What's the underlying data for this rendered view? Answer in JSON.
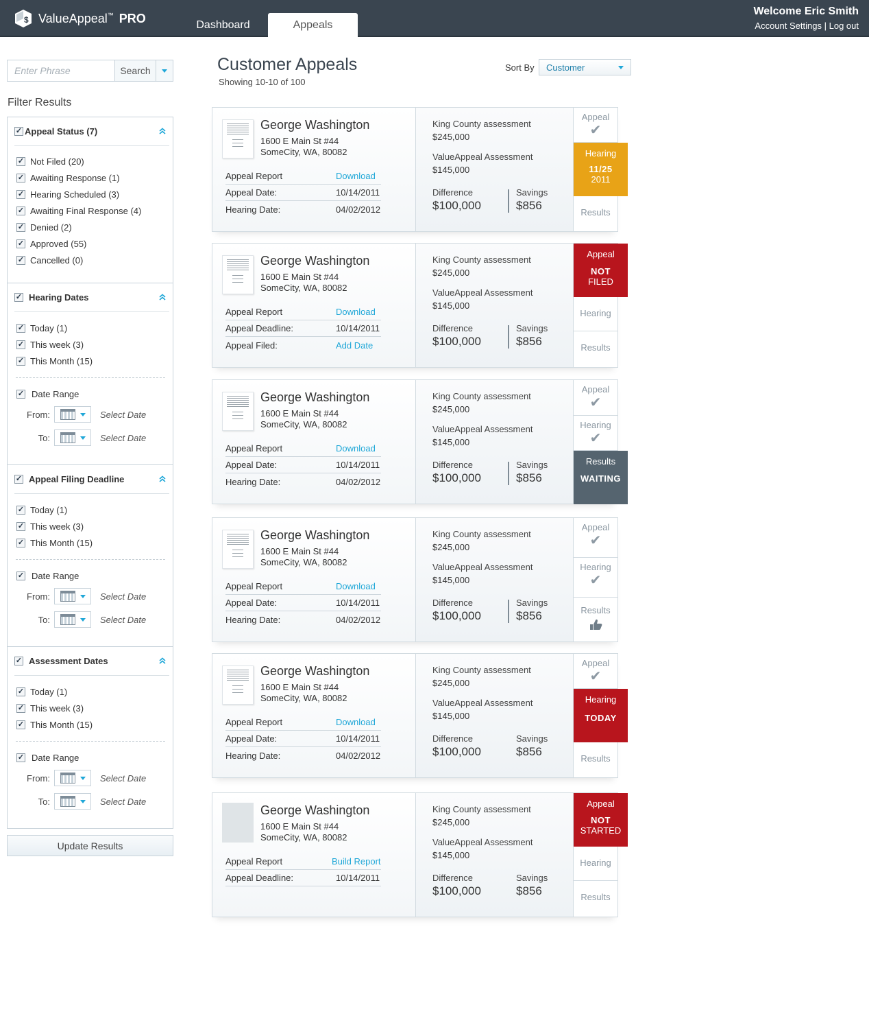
{
  "app": {
    "name": "ValueAppeal",
    "trademark": "™",
    "edition": "PRO"
  },
  "nav": {
    "tabs": [
      {
        "label": "Dashboard",
        "active": false
      },
      {
        "label": "Appeals",
        "active": true
      }
    ]
  },
  "user": {
    "welcome": "Welcome Eric Smith",
    "account_settings": "Account Settings",
    "separator": "|",
    "logout": "Log out"
  },
  "search": {
    "placeholder": "Enter Phrase",
    "button": "Search"
  },
  "filters": {
    "title": "Filter Results",
    "appeal_status": {
      "label": "Appeal Status (7)",
      "items": [
        "Not Filed (20)",
        "Awaiting Response (1)",
        "Hearing Scheduled (3)",
        "Awaiting Final Response (4)",
        "Denied (2)",
        "Approved (55)",
        "Cancelled (0)"
      ]
    },
    "hearing_dates": {
      "label": "Hearing Dates",
      "items": [
        "Today (1)",
        "This week (3)",
        "This Month (15)"
      ],
      "date_range": "Date Range"
    },
    "appeal_filing_deadline": {
      "label": "Appeal Filing Deadline",
      "items": [
        "Today (1)",
        "This week (3)",
        "This Month (15)"
      ],
      "date_range": "Date Range"
    },
    "assessment_dates": {
      "label": "Assessment Dates",
      "items": [
        "Today (1)",
        "This week (3)",
        "This Month (15)"
      ],
      "date_range": "Date Range"
    },
    "from_label": "From:",
    "to_label": "To:",
    "select_date": "Select Date",
    "update_button": "Update Results"
  },
  "main": {
    "title": "Customer Appeals",
    "showing": "Showing 10-10 of 100",
    "sort_by_label": "Sort By",
    "sort_by_value": "Customer"
  },
  "labels": {
    "king_county": "King County assessment",
    "valueappeal_assessment": "ValueAppeal Assessment",
    "difference": "Difference",
    "savings": "Savings",
    "appeal_report": "Appeal Report"
  },
  "cards": [
    {
      "name": "George Washington",
      "address1": "1600 E Main St #44",
      "address2": "SomeCity, WA, 80082",
      "report_action": "Download",
      "row2_label": "Appeal Date:",
      "row2_value": "10/14/2011",
      "row3_label": "Hearing Date:",
      "row3_value": "04/02/2012",
      "king_value": "$245,000",
      "va_value": "$145,000",
      "difference": "$100,000",
      "savings": "$856",
      "status": {
        "appeal": "Appeal",
        "hearing_title": "Hearing",
        "hearing_date": "11/25",
        "hearing_year": "2011",
        "results": "Results"
      }
    },
    {
      "name": "George Washington",
      "address1": "1600 E Main St #44",
      "address2": "SomeCity, WA, 80082",
      "report_action": "Download",
      "row2_label": "Appeal Deadline:",
      "row2_value": "10/14/2011",
      "row3_label": "Appeal Filed:",
      "row3_value": "Add Date",
      "king_value": "$245,000",
      "va_value": "$145,000",
      "difference": "$100,000",
      "savings": "$856",
      "status": {
        "appeal_title": "Appeal",
        "appeal_line1": "NOT",
        "appeal_line2": "FILED",
        "hearing": "Hearing",
        "results": "Results"
      }
    },
    {
      "name": "George Washington",
      "address1": "1600 E Main St #44",
      "address2": "SomeCity, WA, 80082",
      "report_action": "Download",
      "row2_label": "Appeal Date:",
      "row2_value": "10/14/2011",
      "row3_label": "Hearing Date:",
      "row3_value": "04/02/2012",
      "king_value": "$245,000",
      "va_value": "$145,000",
      "difference": "$100,000",
      "savings": "$856",
      "status": {
        "appeal": "Appeal",
        "hearing": "Hearing",
        "results_title": "Results",
        "results_state": "WAITING"
      }
    },
    {
      "name": "George Washington",
      "address1": "1600 E Main St #44",
      "address2": "SomeCity, WA, 80082",
      "report_action": "Download",
      "row2_label": "Appeal Date:",
      "row2_value": "10/14/2011",
      "row3_label": "Hearing Date:",
      "row3_value": "04/02/2012",
      "king_value": "$245,000",
      "va_value": "$145,000",
      "difference": "$100,000",
      "savings": "$856",
      "status": {
        "appeal": "Appeal",
        "hearing": "Hearing",
        "results": "Results"
      }
    },
    {
      "name": "George Washington",
      "address1": "1600 E Main St #44",
      "address2": "SomeCity, WA, 80082",
      "report_action": "Download",
      "row2_label": "Appeal Date:",
      "row2_value": "10/14/2011",
      "row3_label": "Hearing Date:",
      "row3_value": "04/02/2012",
      "king_value": "$245,000",
      "va_value": "$145,000",
      "difference": "$100,000",
      "savings": "$856",
      "status": {
        "appeal": "Appeal",
        "hearing_title": "Hearing",
        "hearing_state": "TODAY",
        "results": "Results"
      }
    },
    {
      "name": "George Washington",
      "address1": "1600 E Main St #44",
      "address2": "SomeCity, WA, 80082",
      "report_action": "Build Report",
      "row2_label": "Appeal Deadline:",
      "row2_value": "10/14/2011",
      "king_value": "$245,000",
      "va_value": "$145,000",
      "difference": "$100,000",
      "savings": "$856",
      "status": {
        "appeal_title": "Appeal",
        "appeal_line1": "NOT",
        "appeal_line2": "STARTED",
        "hearing": "Hearing",
        "results": "Results"
      }
    }
  ],
  "colors": {
    "topbar": "#3a4550",
    "accent": "#1fa7d8",
    "status_orange": "#e8a317",
    "status_red": "#b8151d",
    "status_gray": "#55646f"
  }
}
